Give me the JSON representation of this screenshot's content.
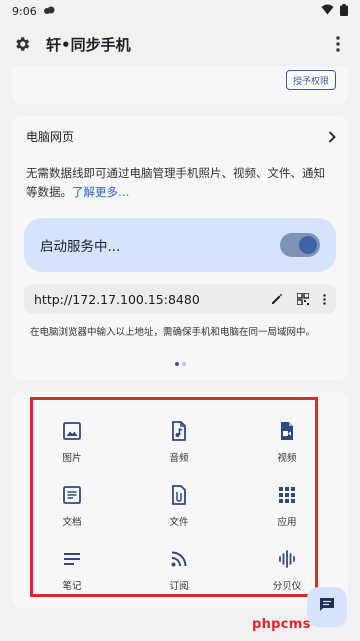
{
  "status_bar": {
    "time": "9:06",
    "icons": [
      "cloud-sync-icon",
      "wifi-icon",
      "battery-icon"
    ]
  },
  "app_bar": {
    "title": "轩•同步手机",
    "left_icon": "gear-icon",
    "right_icon": "more-vertical-icon"
  },
  "top_card": {
    "permission_button": "授予权限"
  },
  "web_card": {
    "title": "电脑网页",
    "description": "无需数据线即可通过电脑管理手机照片、视频、文件、通知等数据。",
    "learn_more": "了解更多…",
    "service_label": "启动服务中...",
    "service_on": true,
    "url": "http://172.17.100.15:8480",
    "url_hint": "在电脑浏览器中输入以上地址，需确保手机和电脑在同一局域网中。",
    "page_count": 2,
    "active_page": 1
  },
  "grid": {
    "items": [
      {
        "label": "图片",
        "icon": "image-icon"
      },
      {
        "label": "音频",
        "icon": "audio-file-icon"
      },
      {
        "label": "视频",
        "icon": "video-file-icon"
      },
      {
        "label": "文档",
        "icon": "document-icon"
      },
      {
        "label": "文件",
        "icon": "attachment-file-icon"
      },
      {
        "label": "应用",
        "icon": "apps-grid-icon"
      },
      {
        "label": "笔记",
        "icon": "notes-icon"
      },
      {
        "label": "订阅",
        "icon": "rss-feed-icon"
      },
      {
        "label": "分贝仪",
        "icon": "sound-wave-icon"
      }
    ]
  },
  "fab": {
    "icon": "chat-icon"
  },
  "watermark": "phpcms",
  "colors": {
    "accent": "#3b5998",
    "pill_bg": "#d5e3fb",
    "highlight_frame": "#e0262a"
  }
}
